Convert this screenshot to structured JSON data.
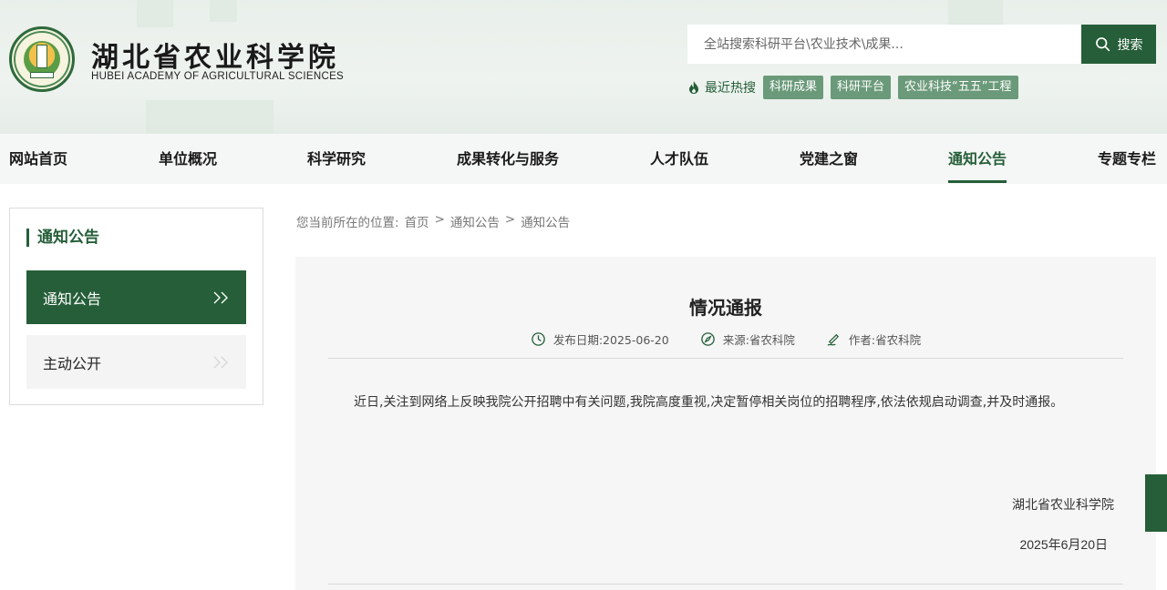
{
  "header": {
    "logo_cn": "湖北省农业科学院",
    "logo_en": "HUBEI ACADEMY OF AGRICULTURAL SCIENCES",
    "search_placeholder": "全站搜索科研平台\\农业技术\\成果...",
    "search_button": "搜索",
    "hot_label": "最近热搜",
    "hot_tags": [
      "科研成果",
      "科研平台",
      "农业科技“五五”工程"
    ]
  },
  "nav": {
    "items": [
      "网站首页",
      "单位概况",
      "科学研究",
      "成果转化与服务",
      "人才队伍",
      "党建之窗",
      "通知公告",
      "专题专栏"
    ],
    "active": "通知公告"
  },
  "sidebar": {
    "title": "通知公告",
    "items": [
      "通知公告",
      "主动公开"
    ]
  },
  "breadcrumb": {
    "prefix": "您当前所在的位置:",
    "items": [
      "首页",
      "通知公告",
      "通知公告"
    ],
    "separator": ">"
  },
  "article": {
    "title": "情况通报",
    "meta": {
      "date": "发布日期:2025-06-20",
      "source": "来源:省农科院",
      "author": "作者:省农科院"
    },
    "body": "近日,关注到网络上反映我院公开招聘中有关问题,我院高度重视,决定暂停相关岗位的招聘程序,依法依规启动调查,并及时通报。",
    "signature": "湖北省农业科学院",
    "sign_date": "2025年6月20日"
  },
  "colors": {
    "brand_green": "#255e38",
    "tag_green": "#6b9a7a"
  }
}
